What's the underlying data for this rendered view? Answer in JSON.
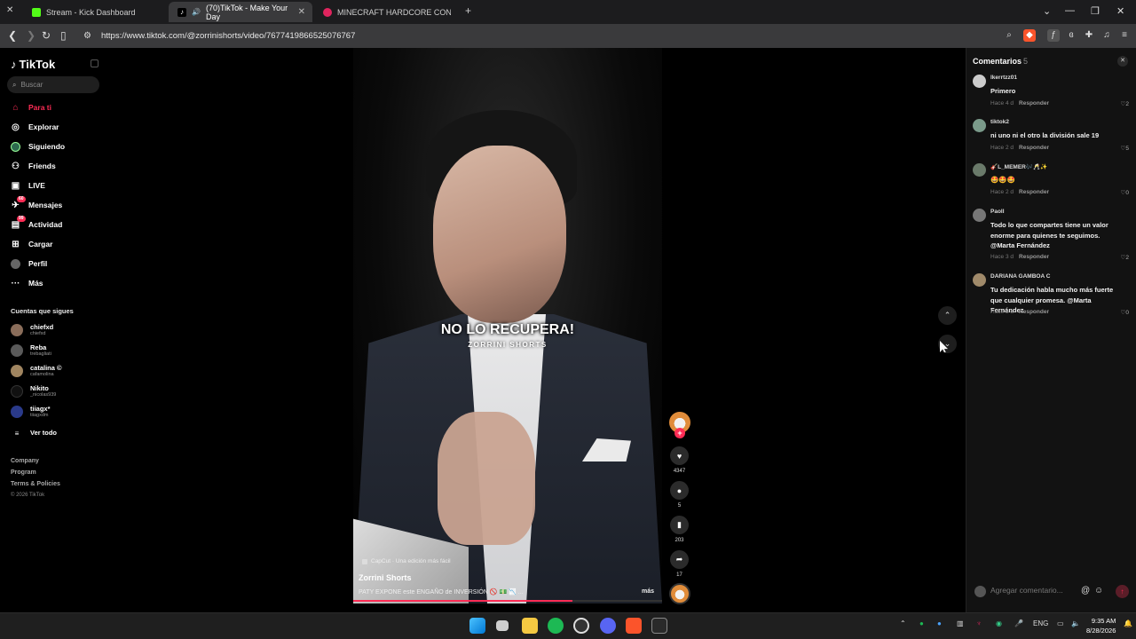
{
  "browser": {
    "tabs": [
      {
        "title": "Stream - Kick Dashboard",
        "favicon_color": "#53fc18"
      },
      {
        "title": "(70)TikTok - Make Your Day",
        "favicon_color": "#ffffff"
      },
      {
        "title": "MINECRAFT HARDCORE CON AURO",
        "favicon_color": "#e0245e"
      }
    ],
    "url": "https://www.tiktok.com/@zorrinishorts/video/7677419866525076767"
  },
  "sidebar": {
    "logo": "TikTok",
    "search_placeholder": "Buscar",
    "nav": [
      {
        "label": "Para ti",
        "active": true
      },
      {
        "label": "Explorar"
      },
      {
        "label": "Siguiendo"
      },
      {
        "label": "Friends"
      },
      {
        "label": "LIVE"
      },
      {
        "label": "Mensajes",
        "badge": "60"
      },
      {
        "label": "Actividad",
        "badge": "99"
      },
      {
        "label": "Cargar"
      },
      {
        "label": "Perfil"
      },
      {
        "label": "Más"
      }
    ],
    "following_title": "Cuentas que sigues",
    "following": [
      {
        "name": "chiefxd",
        "handle": "chiefxd"
      },
      {
        "name": "Reba",
        "handle": "trebagliati"
      },
      {
        "name": "catalina ©",
        "handle": "cafamolina"
      },
      {
        "name": "Nikito",
        "handle": "_nicolas939"
      },
      {
        "name": "tiiagx*",
        "handle": "tiiagxdm"
      }
    ],
    "see_all": "Ver todo",
    "footer": [
      "Company",
      "Program",
      "Terms & Policies",
      "© 2026 TikTok"
    ]
  },
  "video": {
    "caption_main": "NO LO RECUPERA!",
    "caption_sub": "ZORRINI SHORTS",
    "capcut": "CapCut · Una edición más fácil",
    "author": "Zorrini Shorts",
    "description": "PATY EXPONE este ENGAÑO de INVERSIÓN 🚫 💵 📉 ...",
    "more": "más",
    "progress": 0.71,
    "actions": {
      "likes": "4347",
      "comments": "5",
      "saves": "203",
      "shares": "17"
    }
  },
  "comments": {
    "title": "Comentarios",
    "count": "5",
    "items": [
      {
        "user": "lkerrtzz01",
        "text": "Primero",
        "time": "Hace 4 d",
        "reply": "Responder",
        "likes": "2"
      },
      {
        "user": "tiktok2",
        "text": "ni uno ni el otro la división sale 19",
        "time": "Hace 2 d",
        "reply": "Responder",
        "likes": "5"
      },
      {
        "user": "🎸L_MEMER🎶🥂✨",
        "text": "🤩🤩🤩",
        "time": "Hace 2 d",
        "reply": "Responder",
        "likes": "0"
      },
      {
        "user": "Paoll",
        "text": "Todo lo que compartes tiene un valor enorme para quienes te seguimos. @Marta Fernández",
        "time": "Hace 3 d",
        "reply": "Responder",
        "likes": "2"
      },
      {
        "user": "DARIANA GAMBOA C",
        "text": "Tu dedicación habla mucho más fuerte que cualquier promesa. @Marta Fernández",
        "time": "Hace 3 d",
        "reply": "Responder",
        "likes": "0"
      }
    ],
    "input_placeholder": "Agregar comentario..."
  },
  "taskbar": {
    "lang": "ENG",
    "time": "9:35 AM",
    "date": "8/28/2026"
  }
}
